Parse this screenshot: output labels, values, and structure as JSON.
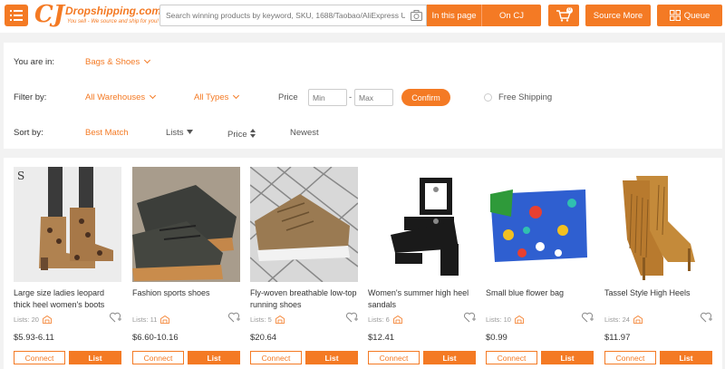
{
  "header": {
    "logo_brand": "Dropshipping.com",
    "logo_tagline": "You sell - We source and ship for you!",
    "search_placeholder": "Search winning products by keyword, SKU, 1688/Taobao/AliExpress URL",
    "in_this_page_label": "In this page",
    "on_cj_label": "On CJ",
    "cart_count": "0",
    "source_more_label": "Source More",
    "queue_label": "Queue"
  },
  "filters": {
    "you_are_in_label": "You are in:",
    "category": "Bags & Shoes",
    "filter_by_label": "Filter by:",
    "warehouses": "All Warehouses",
    "types": "All Types",
    "price_label": "Price",
    "min_placeholder": "Min",
    "dash": "-",
    "max_placeholder": "Max",
    "confirm_label": "Confirm",
    "free_shipping_label": "Free Shipping",
    "sort_by_label": "Sort by:",
    "sort_best_match": "Best Match",
    "sort_lists": "Lists",
    "sort_price": "Price",
    "sort_newest": "Newest"
  },
  "colors": {
    "accent": "#f47a24"
  },
  "products": [
    {
      "title": "Large size ladies leopard thick heel women's boots",
      "lists": "Lists: 20",
      "price": "$5.93-6.11",
      "connect": "Connect",
      "list": "List"
    },
    {
      "title": "Fashion sports shoes",
      "lists": "Lists: 11",
      "price": "$6.60-10.16",
      "connect": "Connect",
      "list": "List"
    },
    {
      "title": "Fly-woven breathable low-top running shoes",
      "lists": "Lists: 5",
      "price": "$20.64",
      "connect": "Connect",
      "list": "List"
    },
    {
      "title": "Women's summer high heel sandals",
      "lists": "Lists: 6",
      "price": "$12.41",
      "connect": "Connect",
      "list": "List"
    },
    {
      "title": "Small blue flower bag",
      "lists": "Lists: 10",
      "price": "$0.99",
      "connect": "Connect",
      "list": "List"
    },
    {
      "title": "Tassel Style High Heels",
      "lists": "Lists: 24",
      "price": "$11.97",
      "connect": "Connect",
      "list": "List"
    }
  ]
}
